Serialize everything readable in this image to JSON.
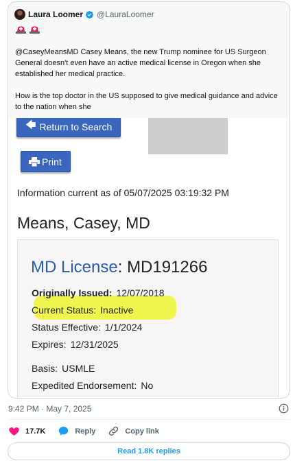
{
  "quoted_tweet": {
    "author_name": "Laura Loomer",
    "author_handle": "@LauraLoomer",
    "emoji": [
      "siren-icon",
      "siren-icon"
    ],
    "text_p1": "@CaseyMeansMD Casey Means, the new Trump nominee for US Surgeon General doesn't even have an active medical license in Oregon when she established her medical practice.",
    "text_p2": "How is the top doctor in the US supposed to give medical guidance and advice to the nation when she"
  },
  "license_screenshot": {
    "return_button": "Return to Search",
    "print_button": "Print",
    "info_current": "Information current as of 05/07/2025 03:19:32 PM",
    "person_name": "Means, Casey, MD",
    "license_label": "MD License",
    "license_number": "MD191266",
    "fields": [
      {
        "key": "Originally Issued:",
        "value": "12/07/2018"
      },
      {
        "key": "Current Status:",
        "value": "Inactive"
      },
      {
        "key": "Status Effective:",
        "value": "1/1/2024"
      },
      {
        "key": "Expires:",
        "value": "12/31/2025"
      },
      {
        "key": "Basis:",
        "value": "USMLE"
      },
      {
        "key": "Expedited Endorsement:",
        "value": "No"
      }
    ],
    "highlight_color": "#eef53a"
  },
  "footer": {
    "timestamp": "9:42 PM · May 7, 2025",
    "likes": "17.7K",
    "reply_label": "Reply",
    "copy_link_label": "Copy link",
    "read_replies": "Read 1.8K replies"
  },
  "colors": {
    "accent": "#1d9bf0",
    "like": "#f91880",
    "button_blue": "#3a67bd"
  }
}
